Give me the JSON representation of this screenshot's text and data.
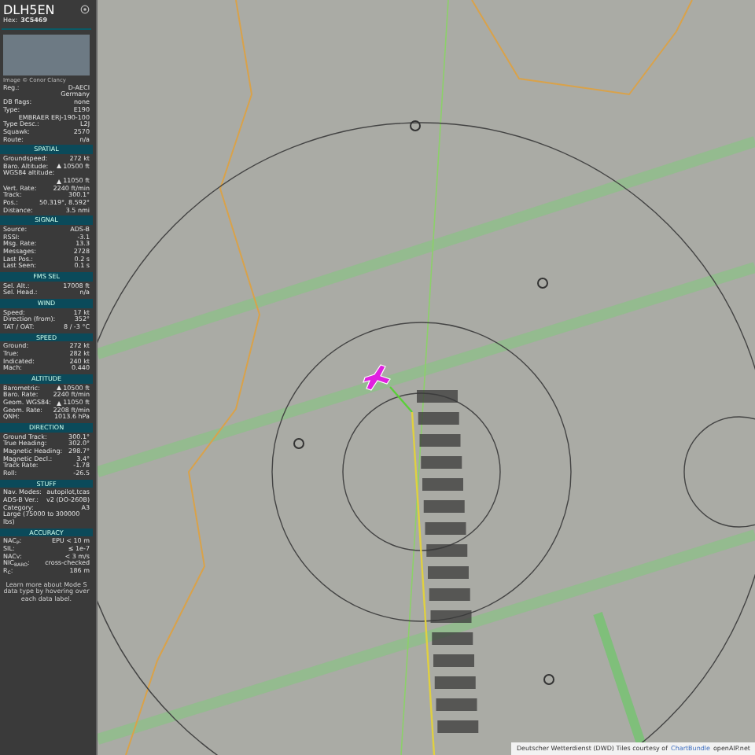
{
  "aircraft": {
    "callsign": "DLH5EN",
    "hex_label": "Hex:",
    "hex": "3C5469"
  },
  "photo": {
    "caption": "Image © Conor Clancy"
  },
  "sections": [
    {
      "rows": [
        {
          "kind": "pair",
          "label": "Reg.:",
          "value": "D-AECI"
        },
        {
          "kind": "value",
          "value": "Germany"
        },
        {
          "kind": "pair",
          "label": "DB flags:",
          "value": "none"
        },
        {
          "kind": "pair",
          "label": "Type:",
          "value": "E190"
        },
        {
          "kind": "value",
          "value": "EMBRAER ERJ-190-100"
        },
        {
          "kind": "pair",
          "label": "Type Desc.:",
          "value": "L2J"
        },
        {
          "kind": "pair",
          "label": "Squawk:",
          "value": "2570"
        },
        {
          "kind": "pair",
          "label": "Route:",
          "value": "n/a"
        }
      ]
    },
    {
      "title": "SPATIAL",
      "rows": [
        {
          "kind": "pair",
          "label": "Groundspeed:",
          "value": "272 kt"
        },
        {
          "kind": "pair",
          "label": "Baro. Altitude:",
          "value": "10500 ft",
          "climbing": true
        },
        {
          "kind": "pair",
          "label": "WGS84 altitude:"
        },
        {
          "kind": "value",
          "value": "11050 ft",
          "climbing": true
        },
        {
          "kind": "pair",
          "label": "Vert. Rate:",
          "value": "2240 ft/min"
        },
        {
          "kind": "pair",
          "label": "Track:",
          "value": "300.1°"
        },
        {
          "kind": "pair",
          "label": "Pos.:",
          "value": "50.319°, 8.592°"
        },
        {
          "kind": "pair",
          "label": "Distance:",
          "value": "3.5 nmi"
        }
      ]
    },
    {
      "title": "SIGNAL",
      "rows": [
        {
          "kind": "pair",
          "label": "Source:",
          "value": "ADS-B"
        },
        {
          "kind": "pair",
          "label": "RSSI:",
          "value": "-3.1"
        },
        {
          "kind": "pair",
          "label": "Msg. Rate:",
          "value": "13.3"
        },
        {
          "kind": "pair",
          "label": "Messages:",
          "value": "2728"
        },
        {
          "kind": "pair",
          "label": "Last Pos.:",
          "value": "0.2 s"
        },
        {
          "kind": "pair",
          "label": "Last Seen:",
          "value": "0.1 s"
        }
      ]
    },
    {
      "title": "FMS SEL",
      "rows": [
        {
          "kind": "pair",
          "label": "Sel. Alt.:",
          "value": "17008 ft"
        },
        {
          "kind": "pair",
          "label": "Sel. Head.:",
          "value": "n/a"
        }
      ]
    },
    {
      "title": "WIND",
      "rows": [
        {
          "kind": "pair",
          "label": "Speed:",
          "value": "17 kt"
        },
        {
          "kind": "pair",
          "label": "Direction (from):",
          "value": "352°"
        },
        {
          "kind": "pair",
          "label": "TAT / OAT:",
          "value": "8 / -3 °C"
        }
      ]
    },
    {
      "title": "SPEED",
      "rows": [
        {
          "kind": "pair",
          "label": "Ground:",
          "value": "272 kt"
        },
        {
          "kind": "pair",
          "label": "True:",
          "value": "282 kt"
        },
        {
          "kind": "pair",
          "label": "Indicated:",
          "value": "240 kt"
        },
        {
          "kind": "pair",
          "label": "Mach:",
          "value": "0.440"
        }
      ]
    },
    {
      "title": "ALTITUDE",
      "rows": [
        {
          "kind": "pair",
          "label": "Barometric:",
          "value": "10500 ft",
          "climbing": true
        },
        {
          "kind": "pair",
          "label": "Baro. Rate:",
          "value": "2240 ft/min"
        },
        {
          "kind": "pair",
          "label": "Geom. WGS84:",
          "value": "11050 ft",
          "climbing": true
        },
        {
          "kind": "pair",
          "label": "Geom. Rate:",
          "value": "2208 ft/min"
        },
        {
          "kind": "pair",
          "label": "QNH:",
          "value": "1013.6 hPa"
        }
      ]
    },
    {
      "title": "DIRECTION",
      "rows": [
        {
          "kind": "pair",
          "label": "Ground Track:",
          "value": "300.1°"
        },
        {
          "kind": "pair",
          "label": "True Heading:",
          "value": "302.0°"
        },
        {
          "kind": "pair",
          "label": "Magnetic Heading:",
          "value": "298.7°"
        },
        {
          "kind": "pair",
          "label": "Magnetic Decl.:",
          "value": "3.4°"
        },
        {
          "kind": "pair",
          "label": "Track Rate:",
          "value": "-1.78"
        },
        {
          "kind": "pair",
          "label": "Roll:",
          "value": "-26.5"
        }
      ]
    },
    {
      "title": "STUFF",
      "rows": [
        {
          "kind": "pair",
          "label": "Nav. Modes:",
          "value": "autopilot,tcas"
        },
        {
          "kind": "pair",
          "label": "ADS-B Ver.:",
          "value": "v2 (DO-260B)"
        },
        {
          "kind": "pair",
          "label": "Category:",
          "value": "A3"
        },
        {
          "kind": "note",
          "value": "Large (75000 to 300000 lbs)"
        }
      ]
    },
    {
      "title": "ACCURACY",
      "rows": [
        {
          "kind": "pair",
          "label": "NAC$_{P}$:",
          "value": "EPU < 10 m"
        },
        {
          "kind": "pair",
          "label": "SIL:",
          "value": "≤ 1e-7"
        },
        {
          "kind": "pair",
          "label": "NAC$_{V}$:",
          "value": "< 3 m/s"
        },
        {
          "kind": "pair",
          "label": "NIC$_{BARO}$:",
          "value": "cross-checked"
        },
        {
          "kind": "pair",
          "label": "R$_{C}$:",
          "value": "186 m"
        }
      ]
    }
  ],
  "footer": "Learn more about Mode S data type by hovering over each data label.",
  "attribution": {
    "text": "Deutscher Wetterdienst (DWD) Tiles courtesy of",
    "links": [
      "ChartBundle",
      "openAIP.net"
    ]
  }
}
